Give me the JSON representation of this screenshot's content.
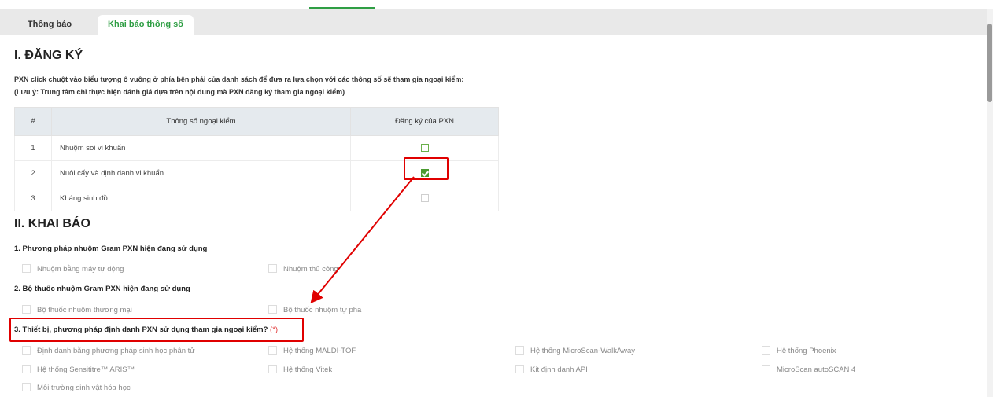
{
  "tabs": {
    "notifications": "Thông báo",
    "declare_params": "Khai báo thông số"
  },
  "section1": {
    "title": "I. ĐĂNG KÝ",
    "note_line1": "PXN click chuột vào biểu tượng ô vuông ở phía bên phải của danh sách để đưa ra lựa chọn với các thông số sẽ tham gia ngoại kiểm:",
    "note_line2": "(Lưu ý: Trung tâm chỉ thực hiện đánh giá dựa trên nội dung mà PXN đăng ký tham gia ngoại kiểm)",
    "table": {
      "headers": [
        "#",
        "Thông số ngoại kiểm",
        "Đăng ký của PXN"
      ],
      "rows": [
        {
          "num": "1",
          "name": "Nhuộm soi vi khuẩn",
          "checked": false
        },
        {
          "num": "2",
          "name": "Nuôi cấy và định danh vi khuẩn",
          "checked": true
        },
        {
          "num": "3",
          "name": "Kháng sinh đồ",
          "checked": false
        }
      ]
    }
  },
  "section2": {
    "title": "II. KHAI BÁO",
    "q1": {
      "label": "1. Phương pháp nhuộm Gram PXN hiện đang sử dụng",
      "options": [
        "Nhuộm bằng máy tự động",
        "Nhuộm thủ công"
      ]
    },
    "q2": {
      "label": "2. Bộ thuốc nhuộm Gram PXN hiện đang sử dụng",
      "options": [
        "Bộ thuốc nhuộm thương mại",
        "Bộ thuốc nhuộm tự pha"
      ]
    },
    "q3": {
      "label": "3. Thiết bị, phương pháp định danh PXN sử dụng tham gia ngoại kiểm?",
      "required_mark": "(*)",
      "options": [
        "Định danh bằng phương pháp sinh học phân tử",
        "Hệ thống MALDI-TOF",
        "Hệ thống MicroScan-WalkAway",
        "Hệ thống Phoenix",
        "Hệ thống Sensititre™ ARIS™",
        "Hệ thống Vitek",
        "Kit định danh API",
        "MicroScan autoSCAN 4",
        "Môi trường sinh vật hóa học"
      ]
    }
  },
  "colors": {
    "accent": "#2f9e44",
    "annotation": "#e00000"
  }
}
